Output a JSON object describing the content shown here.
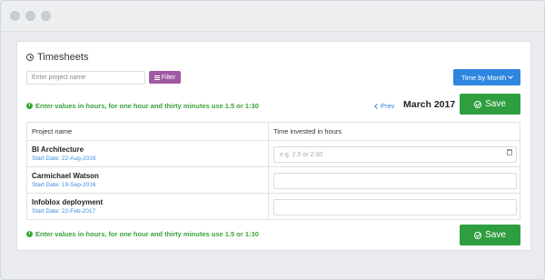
{
  "card": {
    "title": "Timesheets"
  },
  "search": {
    "placeholder": "Enter project name",
    "value": ""
  },
  "filter": {
    "label": "Filter"
  },
  "month_dropdown": {
    "label": "Time by Month"
  },
  "info": {
    "text": "Enter values in hours, for one hour and thirty minutes use 1.5 or 1:30"
  },
  "nav": {
    "prev_label": "Prev",
    "current_month": "March 2017"
  },
  "save": {
    "label": "Save"
  },
  "table": {
    "headers": [
      "Project name",
      "Time invested in hours"
    ],
    "rows": [
      {
        "name": "BI Architecture",
        "start": "Start Date: 22-Aug-2016",
        "hours_placeholder": "e.g. 2.5 or 2:30",
        "hours_value": ""
      },
      {
        "name": "Carmichael Watson",
        "start": "Start Date: 19-Sep-2016",
        "hours_placeholder": "",
        "hours_value": ""
      },
      {
        "name": "Infoblox deployment",
        "start": "Start Date: 22-Feb-2017",
        "hours_placeholder": "",
        "hours_value": ""
      }
    ]
  },
  "colors": {
    "primary": "#2f86e0",
    "success": "#2e9e3f",
    "filter": "#9f5aa3",
    "info_text": "#3aa33a"
  }
}
